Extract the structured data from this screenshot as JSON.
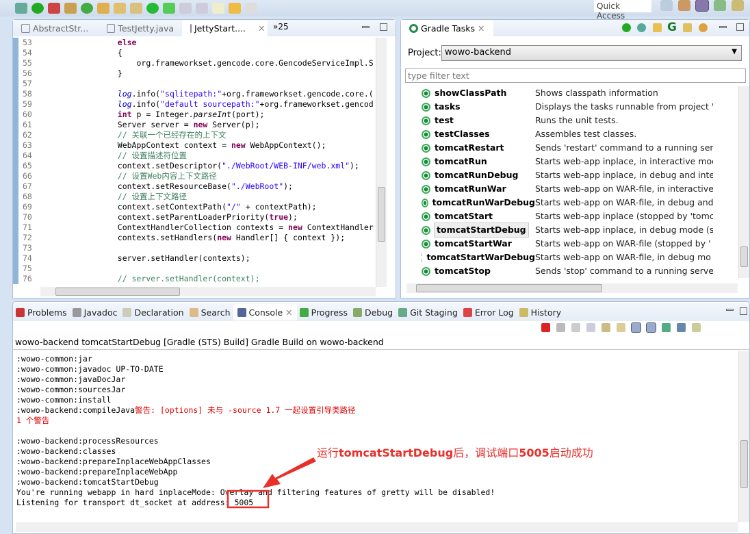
{
  "toolbar": {
    "quick_access": "Quick Access"
  },
  "editor": {
    "tabs": [
      {
        "label": "AbstractStr...",
        "active": false
      },
      {
        "label": "TestJetty.java",
        "active": false
      },
      {
        "label": "JettyStart....",
        "active": true
      }
    ],
    "overflow": "»25",
    "lines": [
      {
        "n": "53",
        "seg": [
          [
            "                ",
            ""
          ],
          [
            "else",
            "kw"
          ]
        ]
      },
      {
        "n": "54",
        "seg": [
          [
            "                {",
            ""
          ]
        ]
      },
      {
        "n": "55",
        "seg": [
          [
            "                    org.frameworkset.gencode.core.GencodeServiceImpl.S",
            ""
          ]
        ]
      },
      {
        "n": "56",
        "seg": [
          [
            "                }",
            ""
          ]
        ]
      },
      {
        "n": "57",
        "seg": [
          [
            "",
            ""
          ]
        ]
      },
      {
        "n": "58",
        "seg": [
          [
            "                ",
            ""
          ],
          [
            "log",
            "fd"
          ],
          [
            ".info(",
            ""
          ],
          [
            "\"sqlitepath:\"",
            "st"
          ],
          [
            "+org.frameworkset.gencode.core.(",
            ""
          ]
        ]
      },
      {
        "n": "59",
        "seg": [
          [
            "                ",
            ""
          ],
          [
            "log",
            "fd"
          ],
          [
            ".info(",
            ""
          ],
          [
            "\"default sourcepath:\"",
            "st"
          ],
          [
            "+org.frameworkset.gencod",
            ""
          ]
        ]
      },
      {
        "n": "60",
        "seg": [
          [
            "                ",
            ""
          ],
          [
            "int",
            "kw"
          ],
          [
            " p = Integer.",
            ""
          ],
          [
            "parseInt",
            "it"
          ],
          [
            "(port);",
            ""
          ]
        ]
      },
      {
        "n": "61",
        "seg": [
          [
            "                Server server = ",
            ""
          ],
          [
            "new",
            "kw"
          ],
          [
            " Server(p);",
            ""
          ]
        ]
      },
      {
        "n": "62",
        "seg": [
          [
            "                ",
            ""
          ],
          [
            "// 关联一个已经存在的上下文",
            "cm"
          ]
        ]
      },
      {
        "n": "63",
        "seg": [
          [
            "                WebAppContext context = ",
            ""
          ],
          [
            "new",
            "kw"
          ],
          [
            " WebAppContext();",
            ""
          ]
        ]
      },
      {
        "n": "64",
        "seg": [
          [
            "                ",
            ""
          ],
          [
            "// 设置描述符位置",
            "cm"
          ]
        ]
      },
      {
        "n": "65",
        "seg": [
          [
            "                context.setDescriptor(",
            ""
          ],
          [
            "\"./WebRoot/WEB-INF/web.xml\"",
            "st"
          ],
          [
            ");",
            ""
          ]
        ]
      },
      {
        "n": "66",
        "seg": [
          [
            "                ",
            ""
          ],
          [
            "// 设置Web内容上下文路径",
            "cm"
          ]
        ]
      },
      {
        "n": "67",
        "seg": [
          [
            "                context.setResourceBase(",
            ""
          ],
          [
            "\"./WebRoot\"",
            "st"
          ],
          [
            ");",
            ""
          ]
        ]
      },
      {
        "n": "68",
        "seg": [
          [
            "                ",
            ""
          ],
          [
            "// 设置上下文路径",
            "cm"
          ]
        ]
      },
      {
        "n": "69",
        "seg": [
          [
            "                context.setContextPath(",
            ""
          ],
          [
            "\"/\"",
            "st"
          ],
          [
            " + contextPath);",
            ""
          ]
        ]
      },
      {
        "n": "70",
        "seg": [
          [
            "                context.setParentLoaderPriority(",
            ""
          ],
          [
            "true",
            "kw"
          ],
          [
            ");",
            ""
          ]
        ]
      },
      {
        "n": "71",
        "seg": [
          [
            "                ContextHandlerCollection contexts = ",
            ""
          ],
          [
            "new",
            "kw"
          ],
          [
            " ContextHandler",
            ""
          ]
        ]
      },
      {
        "n": "72",
        "seg": [
          [
            "                contexts.setHandlers(",
            ""
          ],
          [
            "new",
            "kw"
          ],
          [
            " Handler[] { context });",
            ""
          ]
        ]
      },
      {
        "n": "73",
        "seg": [
          [
            "",
            ""
          ]
        ]
      },
      {
        "n": "74",
        "seg": [
          [
            "                server.setHandler(contexts);",
            ""
          ]
        ]
      },
      {
        "n": "75",
        "seg": [
          [
            "",
            ""
          ]
        ]
      },
      {
        "n": "76",
        "seg": [
          [
            "                ",
            ""
          ],
          [
            "// server.setHandler(context);",
            "cm"
          ]
        ]
      }
    ]
  },
  "gradle": {
    "title": "Gradle Tasks",
    "project_label": "Project:",
    "project_value": "wowo-backend",
    "filter_placeholder": "type filter text",
    "tasks": [
      {
        "name": "showClassPath",
        "desc": "Shows classpath information"
      },
      {
        "name": "tasks",
        "desc": "Displays the tasks runnable from project '"
      },
      {
        "name": "test",
        "desc": "Runs the unit tests."
      },
      {
        "name": "testClasses",
        "desc": "Assembles test classes."
      },
      {
        "name": "tomcatRestart",
        "desc": "Sends 'restart' command to a running ser"
      },
      {
        "name": "tomcatRun",
        "desc": "Starts web-app inplace, in interactive mod"
      },
      {
        "name": "tomcatRunDebug",
        "desc": "Starts web-app inplace, in debug and inte"
      },
      {
        "name": "tomcatRunWar",
        "desc": "Starts web-app on WAR-file, in interactive"
      },
      {
        "name": "tomcatRunWarDebug",
        "desc": "Starts web-app on WAR-file, in debug and"
      },
      {
        "name": "tomcatStart",
        "desc": "Starts web-app inplace (stopped by 'tomc"
      },
      {
        "name": "tomcatStartDebug",
        "desc": "Starts web-app inplace, in debug mode (s",
        "selected": true
      },
      {
        "name": "tomcatStartWar",
        "desc": "Starts web-app on WAR-file (stopped by '"
      },
      {
        "name": "tomcatStartWarDebug",
        "desc": "Starts web-app on WAR-file, in debug mo"
      },
      {
        "name": "tomcatStop",
        "desc": "Sends 'stop' command to a running serve"
      }
    ]
  },
  "bottom": {
    "tabs": [
      {
        "label": "Problems",
        "icon": "problems-icon"
      },
      {
        "label": "Javadoc",
        "icon": "at-icon"
      },
      {
        "label": "Declaration",
        "icon": "declaration-icon"
      },
      {
        "label": "Search",
        "icon": "search-icon"
      },
      {
        "label": "Console",
        "icon": "console-icon",
        "active": true
      },
      {
        "label": "Progress",
        "icon": "progress-icon"
      },
      {
        "label": "Debug",
        "icon": "bug-icon"
      },
      {
        "label": "Git Staging",
        "icon": "git-staging-icon"
      },
      {
        "label": "Error Log",
        "icon": "error-log-icon"
      },
      {
        "label": "History",
        "icon": "history-icon"
      }
    ],
    "console_title": "wowo-backend tomcatStartDebug  [Gradle (STS) Build] Gradle Build on wowo-backend",
    "lines": [
      {
        "t": ":wowo-common:jar"
      },
      {
        "t": ":wowo-common:javadoc UP-TO-DATE"
      },
      {
        "t": ":wowo-common:javaDocJar"
      },
      {
        "t": ":wowo-common:sourcesJar"
      },
      {
        "t": ":wowo-common:install"
      },
      {
        "t": ":wowo-backend:compileJava",
        "warn": "警告: [options] 未与 -source 1.7 一起设置引导类路径"
      },
      {
        "t": "",
        "warn": "1 个警告"
      },
      {
        "t": ""
      },
      {
        "t": ":wowo-backend:processResources"
      },
      {
        "t": ":wowo-backend:classes"
      },
      {
        "t": ":wowo-backend:prepareInplaceWebAppClasses"
      },
      {
        "t": ":wowo-backend:prepareInplaceWebApp"
      },
      {
        "t": ":wowo-backend:tomcatStartDebug"
      },
      {
        "t": "You're running webapp in hard inplaceMode: Overlay and filtering features of gretty will be disabled!"
      },
      {
        "t": "Listening for transport dt_socket at address: 5005"
      }
    ],
    "annotation": {
      "prefix": "运行",
      "bold": "tomcatStartDebug",
      "mid": "后，调试端口",
      "port": "5005",
      "suffix": "启动成功",
      "color": "#e8302a"
    }
  }
}
